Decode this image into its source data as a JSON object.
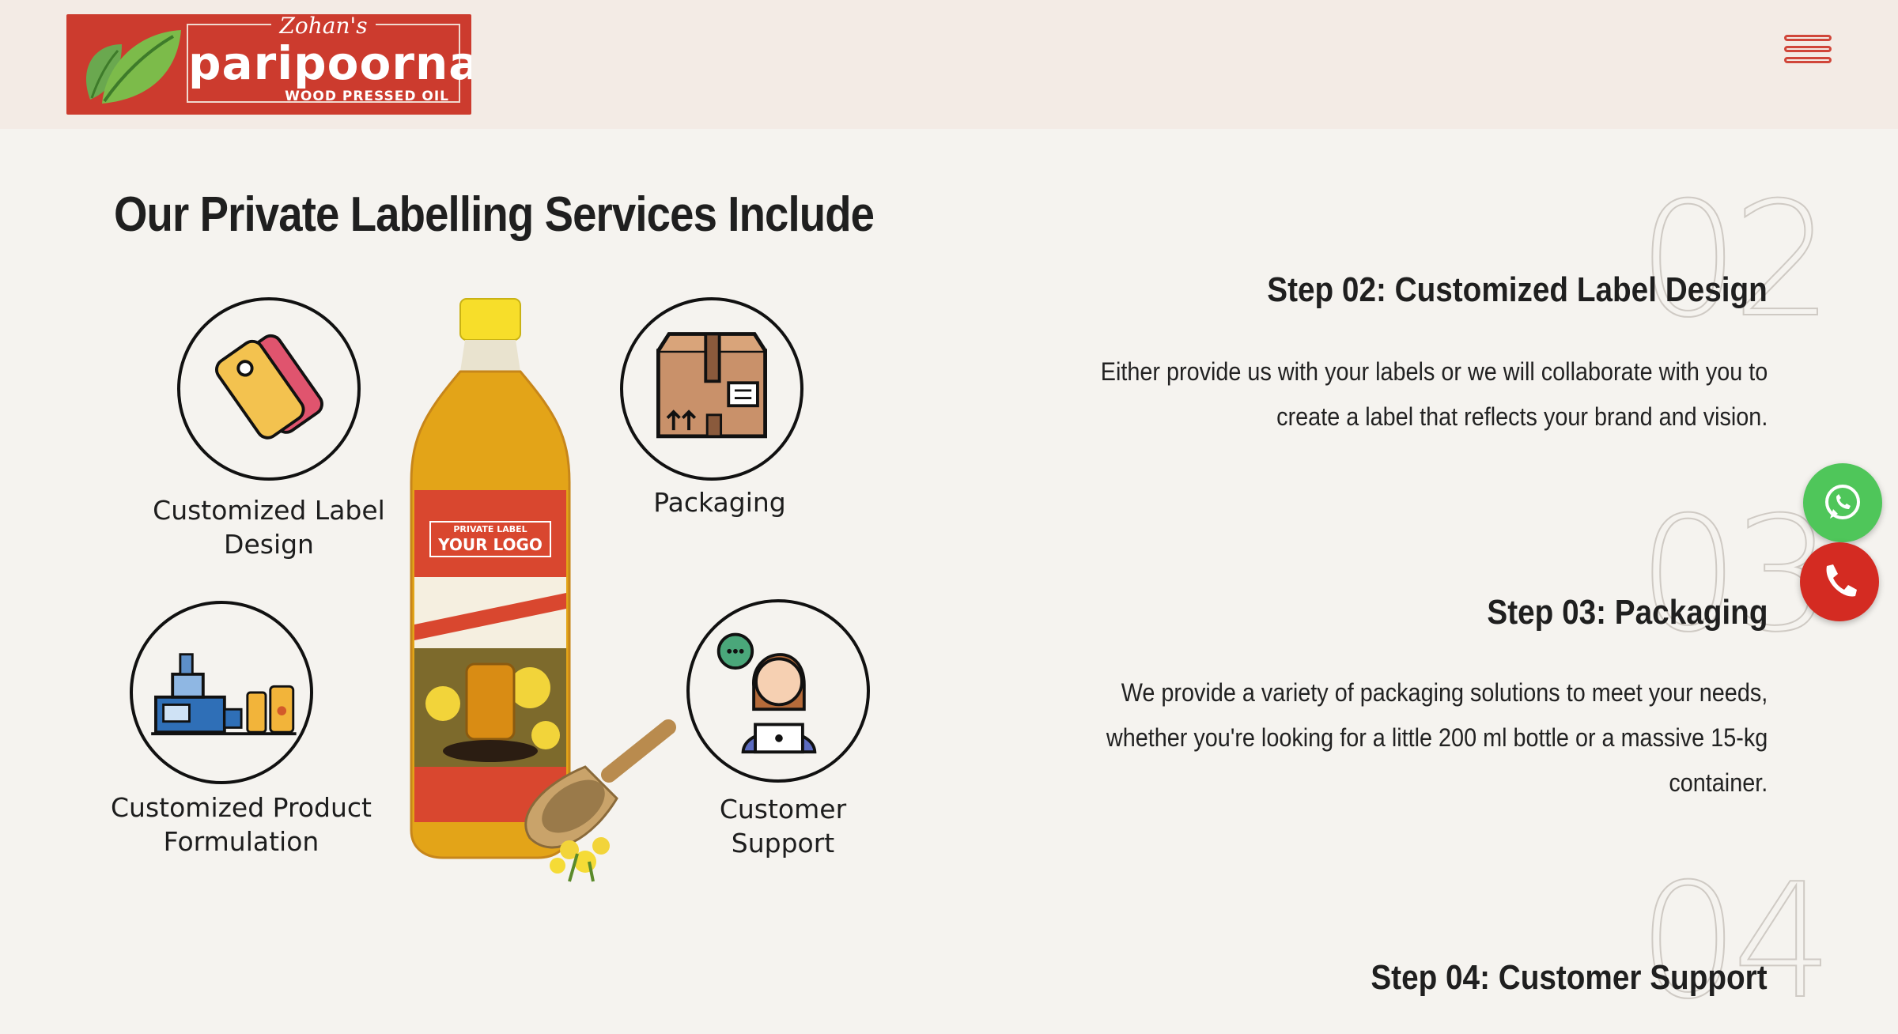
{
  "header": {
    "logo": {
      "script_text": "Zohan's",
      "brand_text": "paripoorna",
      "tagline": "WOOD PRESSED OIL"
    },
    "menu_icon": "hamburger-menu-icon"
  },
  "services": {
    "title": "Our Private Labelling Services Include",
    "items": [
      {
        "label": "Customized Label\nDesign",
        "icon": "price-tag-icon"
      },
      {
        "label": "Packaging",
        "icon": "box-icon"
      },
      {
        "label": "Customized Product\nFormulation",
        "icon": "machine-icon"
      },
      {
        "label": "Customer\nSupport",
        "icon": "support-agent-icon"
      }
    ],
    "bottle": {
      "label_small": "PRIVATE LABEL",
      "label_big": "YOUR LOGO"
    }
  },
  "steps": [
    {
      "number": "02",
      "title": "Step 02: Customized Label Design",
      "desc_lines": [
        "Either provide us with your labels or we will collaborate with you to",
        "create a label that reflects your brand and vision."
      ]
    },
    {
      "number": "03",
      "title": "Step 03: Packaging",
      "desc_lines": [
        "We provide a variety of packaging solutions to meet your needs,",
        "whether you're looking for a little 200 ml bottle or a massive 15-kg",
        "container."
      ]
    },
    {
      "number": "04",
      "title": "Step 04: Customer Support",
      "desc_lines": []
    }
  ],
  "floating": {
    "whatsapp": {
      "icon": "whatsapp-icon",
      "color": "#4fc65a"
    },
    "phone": {
      "icon": "phone-icon",
      "color": "#d42b22"
    }
  },
  "colors": {
    "background": "#f5f3ef",
    "header_bg": "#f3ebe5",
    "brand_red": "#cc3b2e",
    "menu_red": "#d0463a"
  }
}
